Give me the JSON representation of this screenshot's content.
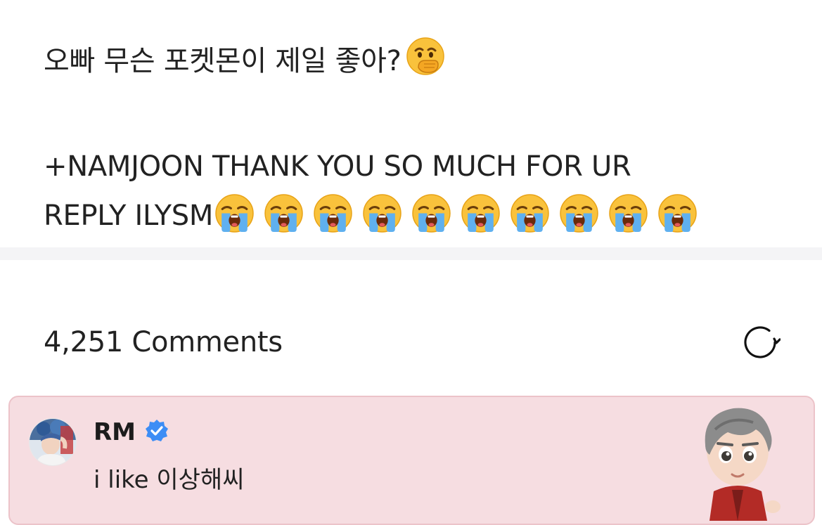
{
  "post": {
    "line1": "오빠 무슨 포켓몬이 제일 좋아?",
    "line1_emoji": "face-with-hand-over-mouth-emoji",
    "line2": "+NAMJOON THANK YOU SO MUCH FOR UR",
    "line3": "REPLY ILYSM",
    "crying_emoji_count": 10,
    "crying_emoji": "loudly-crying-face-emoji"
  },
  "comments": {
    "count_label": "4,251 Comments",
    "refresh_icon": "refresh-icon"
  },
  "comment": {
    "author": "RM",
    "verified_icon": "verified-badge-icon",
    "text": "i like 이상해씨",
    "card_color": "#f6dde1",
    "sticker": "character-sticker"
  }
}
